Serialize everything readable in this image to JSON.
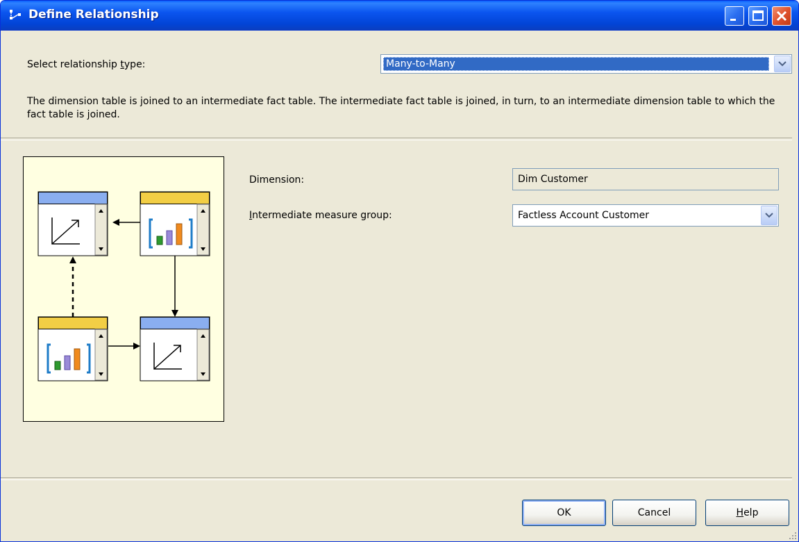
{
  "window": {
    "title": "Define Relationship",
    "controls": [
      "minimize",
      "maximize",
      "close"
    ]
  },
  "relationship_type": {
    "label_prefix": "Select relationship ",
    "label_accel": "t",
    "label_suffix": "ype:",
    "selected": "Many-to-Many"
  },
  "description": "The dimension table is joined to an intermediate fact table. The intermediate fact table is joined, in turn, to an intermediate dimension table to which the fact table is joined.",
  "diagram": {
    "icon": "many-to-many-relationship-diagram",
    "colors": {
      "dimension_header": "#8AAEF0",
      "fact_header": "#F2CE45",
      "background": "#FFFFE1"
    }
  },
  "form": {
    "dimension_label": "Dimension:",
    "dimension_value": "Dim Customer",
    "intermediate_label_accel": "I",
    "intermediate_label_rest": "ntermediate measure group:",
    "intermediate_value": "Factless Account Customer"
  },
  "buttons": {
    "ok": "OK",
    "cancel": "Cancel",
    "help_accel": "H",
    "help_rest": "elp"
  }
}
